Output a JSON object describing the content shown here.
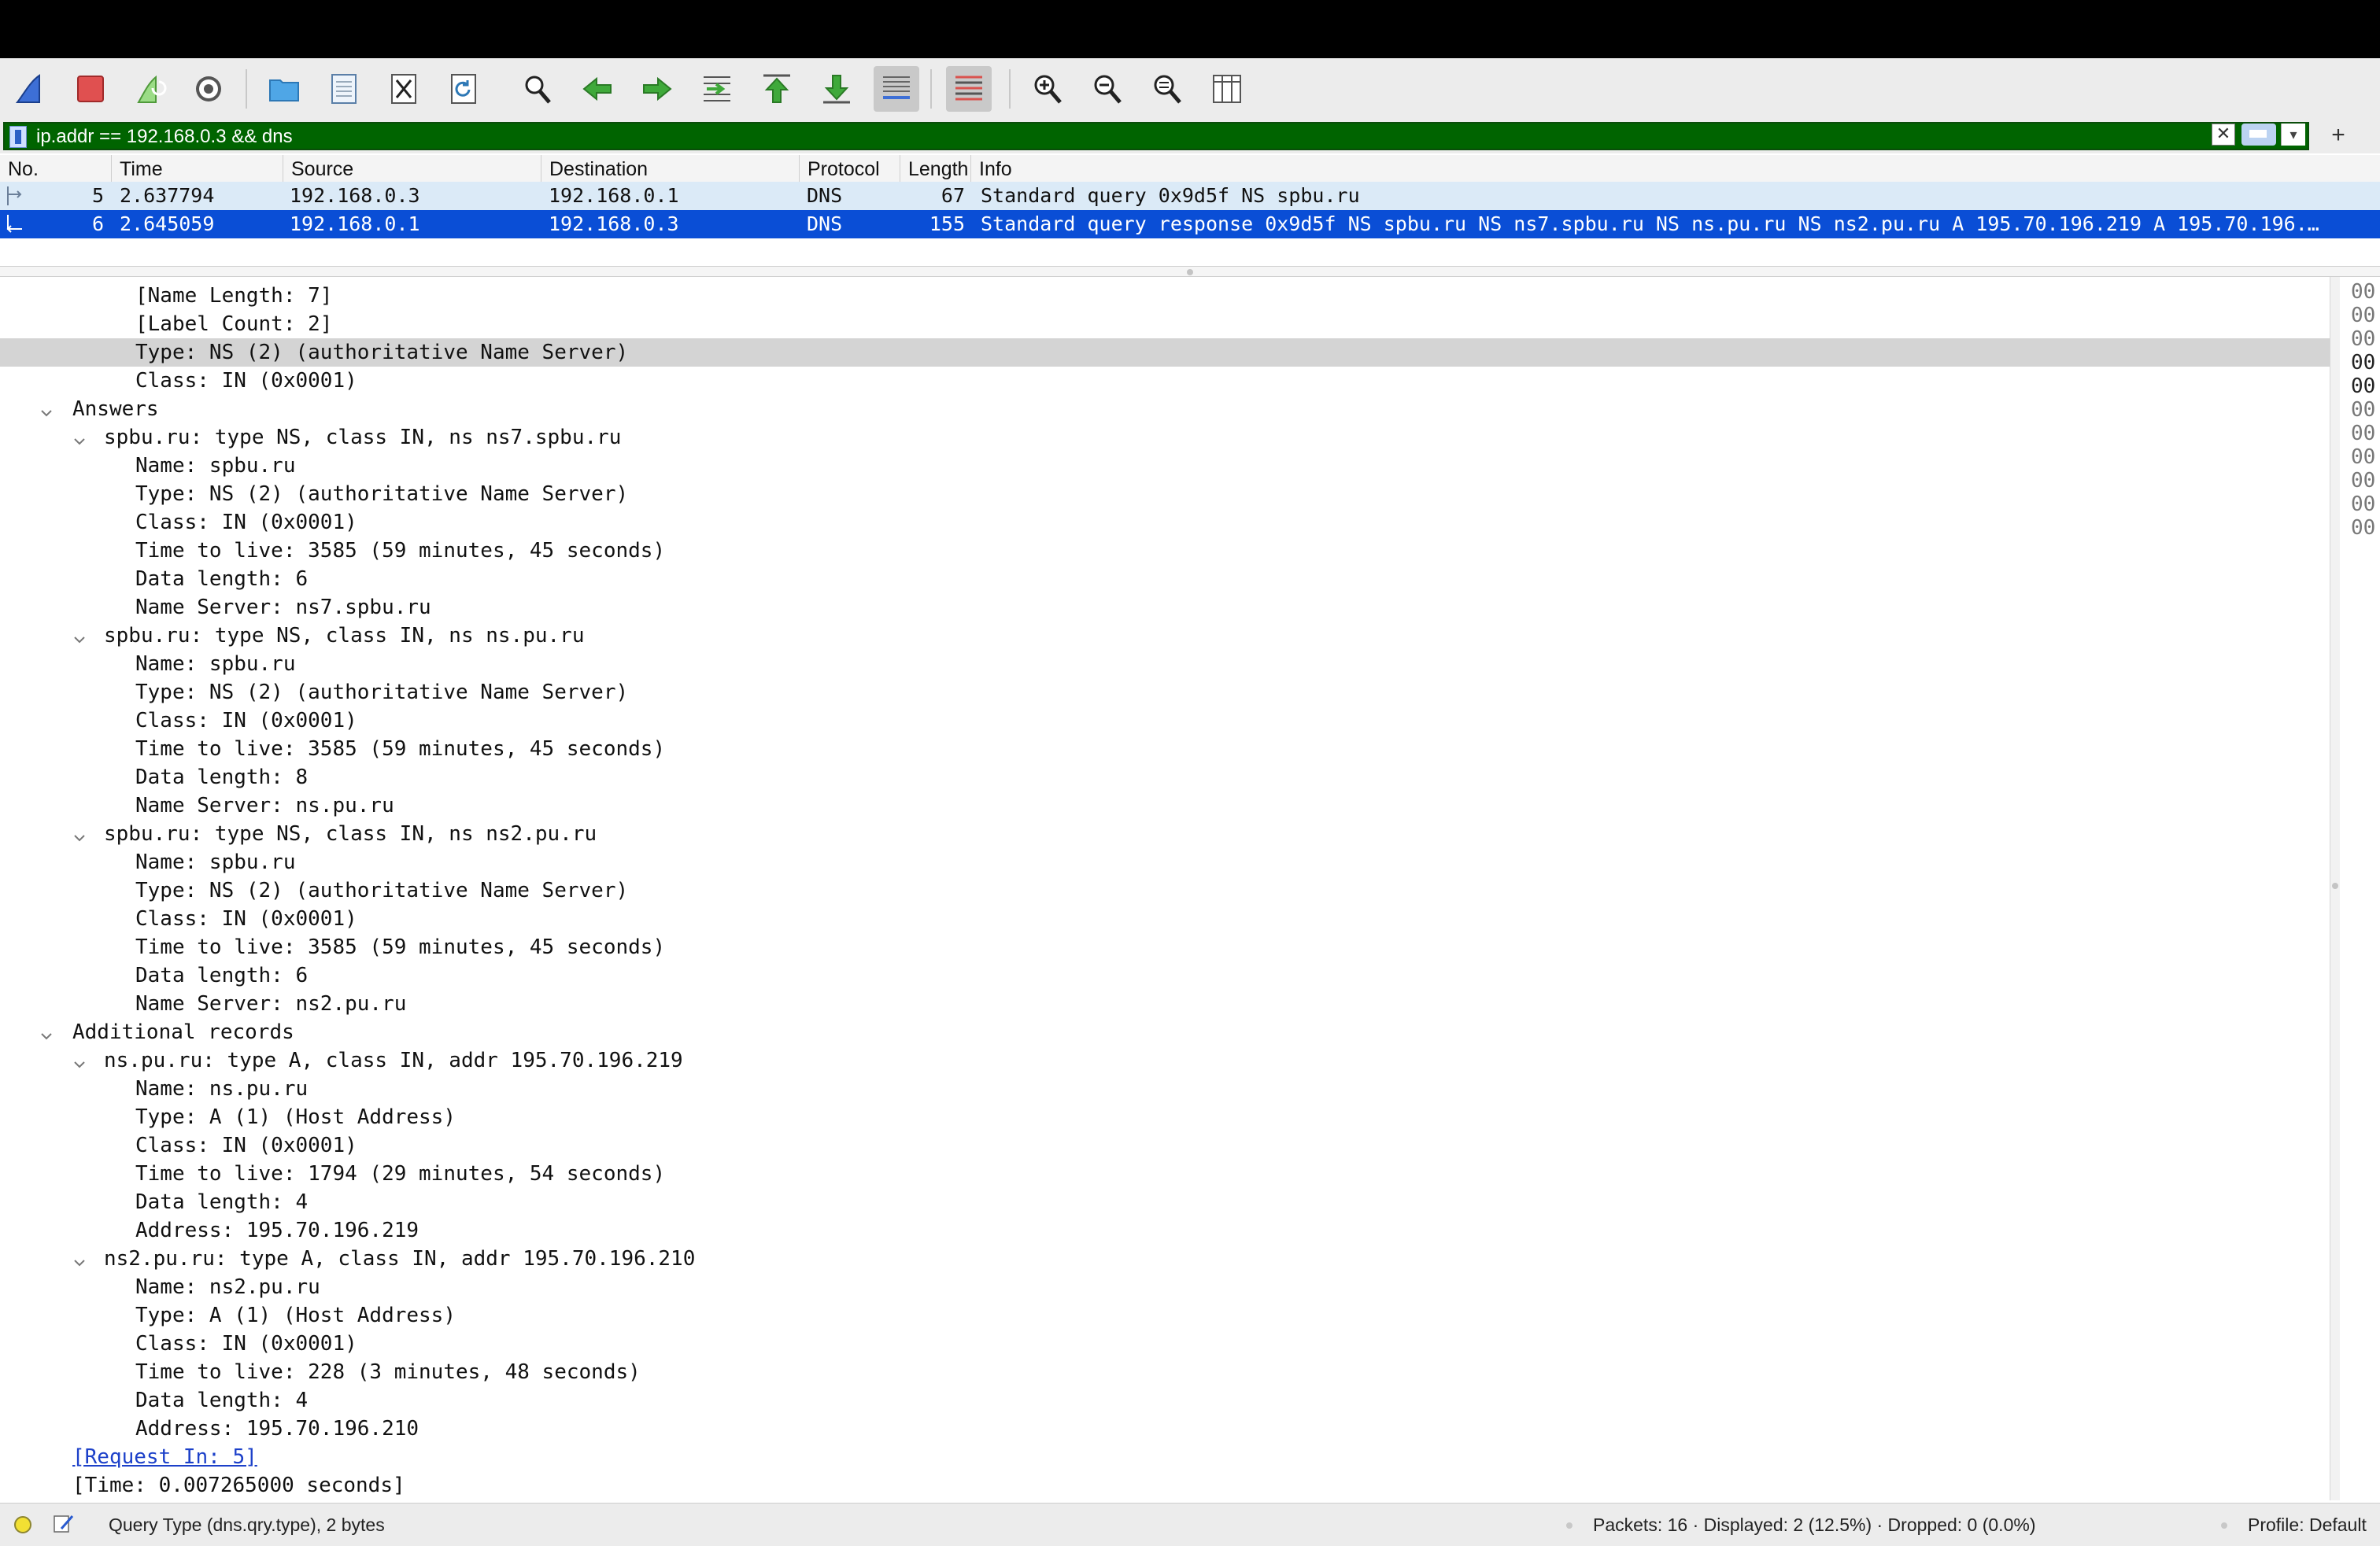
{
  "toolbar": {
    "buttons": [
      "shark-fin-icon",
      "stop-icon",
      "restart-capture-icon",
      "capture-options-icon",
      "open-file-icon",
      "save-file-icon",
      "close-file-icon",
      "reload-icon",
      "find-icon",
      "go-back-icon",
      "go-forward-icon",
      "go-to-packet-icon",
      "first-packet-icon",
      "last-packet-icon",
      "auto-scroll-icon",
      "colorize-icon",
      "zoom-in-icon",
      "zoom-out-icon",
      "normal-size-icon",
      "resize-columns-icon"
    ]
  },
  "filter": {
    "value": "ip.addr == 192.168.0.3 && dns",
    "clear": "✕",
    "recent": "▾",
    "add": "+"
  },
  "columns": {
    "no": "No.",
    "time": "Time",
    "source": "Source",
    "destination": "Destination",
    "protocol": "Protocol",
    "length": "Length",
    "info": "Info"
  },
  "packets": [
    {
      "no": "5",
      "time": "2.637794",
      "source": "192.168.0.3",
      "destination": "192.168.0.1",
      "protocol": "DNS",
      "length": "67",
      "info": "Standard query 0x9d5f NS spbu.ru"
    },
    {
      "no": "6",
      "time": "2.645059",
      "source": "192.168.0.1",
      "destination": "192.168.0.3",
      "protocol": "DNS",
      "length": "155",
      "info": "Standard query response 0x9d5f NS spbu.ru NS ns7.spbu.ru NS ns.pu.ru NS ns2.pu.ru A 195.70.196.219 A 195.70.196.…"
    }
  ],
  "details": [
    {
      "text": "[Name Length: 7]",
      "indent": 4
    },
    {
      "text": "[Label Count: 2]",
      "indent": 4
    },
    {
      "text": "Type: NS (2) (authoritative Name Server)",
      "indent": 4,
      "selected": true
    },
    {
      "text": "Class: IN (0x0001)",
      "indent": 4
    },
    {
      "text": "Answers",
      "indent": 2,
      "expanded": true
    },
    {
      "text": "spbu.ru: type NS, class IN, ns ns7.spbu.ru",
      "indent": 3,
      "expanded": true
    },
    {
      "text": "Name: spbu.ru",
      "indent": 4
    },
    {
      "text": "Type: NS (2) (authoritative Name Server)",
      "indent": 4
    },
    {
      "text": "Class: IN (0x0001)",
      "indent": 4
    },
    {
      "text": "Time to live: 3585 (59 minutes, 45 seconds)",
      "indent": 4
    },
    {
      "text": "Data length: 6",
      "indent": 4
    },
    {
      "text": "Name Server: ns7.spbu.ru",
      "indent": 4
    },
    {
      "text": "spbu.ru: type NS, class IN, ns ns.pu.ru",
      "indent": 3,
      "expanded": true
    },
    {
      "text": "Name: spbu.ru",
      "indent": 4
    },
    {
      "text": "Type: NS (2) (authoritative Name Server)",
      "indent": 4
    },
    {
      "text": "Class: IN (0x0001)",
      "indent": 4
    },
    {
      "text": "Time to live: 3585 (59 minutes, 45 seconds)",
      "indent": 4
    },
    {
      "text": "Data length: 8",
      "indent": 4
    },
    {
      "text": "Name Server: ns.pu.ru",
      "indent": 4
    },
    {
      "text": "spbu.ru: type NS, class IN, ns ns2.pu.ru",
      "indent": 3,
      "expanded": true
    },
    {
      "text": "Name: spbu.ru",
      "indent": 4
    },
    {
      "text": "Type: NS (2) (authoritative Name Server)",
      "indent": 4
    },
    {
      "text": "Class: IN (0x0001)",
      "indent": 4
    },
    {
      "text": "Time to live: 3585 (59 minutes, 45 seconds)",
      "indent": 4
    },
    {
      "text": "Data length: 6",
      "indent": 4
    },
    {
      "text": "Name Server: ns2.pu.ru",
      "indent": 4
    },
    {
      "text": "Additional records",
      "indent": 2,
      "expanded": true
    },
    {
      "text": "ns.pu.ru: type A, class IN, addr 195.70.196.219",
      "indent": 3,
      "expanded": true
    },
    {
      "text": "Name: ns.pu.ru",
      "indent": 4
    },
    {
      "text": "Type: A (1) (Host Address)",
      "indent": 4
    },
    {
      "text": "Class: IN (0x0001)",
      "indent": 4
    },
    {
      "text": "Time to live: 1794 (29 minutes, 54 seconds)",
      "indent": 4
    },
    {
      "text": "Data length: 4",
      "indent": 4
    },
    {
      "text": "Address: 195.70.196.219",
      "indent": 4
    },
    {
      "text": "ns2.pu.ru: type A, class IN, addr 195.70.196.210",
      "indent": 3,
      "expanded": true
    },
    {
      "text": "Name: ns2.pu.ru",
      "indent": 4
    },
    {
      "text": "Type: A (1) (Host Address)",
      "indent": 4
    },
    {
      "text": "Class: IN (0x0001)",
      "indent": 4
    },
    {
      "text": "Time to live: 228 (3 minutes, 48 seconds)",
      "indent": 4
    },
    {
      "text": "Data length: 4",
      "indent": 4
    },
    {
      "text": "Address: 195.70.196.210",
      "indent": 4
    },
    {
      "text": "[Request In: 5]",
      "indent": 2,
      "link": true
    },
    {
      "text": "[Time: 0.007265000 seconds]",
      "indent": 2
    }
  ],
  "bytes": [
    "00",
    "00",
    "00",
    "00",
    "00",
    "00",
    "00",
    "00",
    "00",
    "00",
    "00"
  ],
  "status": {
    "field": "Query Type (dns.qry.type), 2 bytes",
    "packets": "Packets: 16 · Displayed: 2 (12.5%) · Dropped: 0 (0.0%)",
    "profile": "Profile: Default"
  }
}
